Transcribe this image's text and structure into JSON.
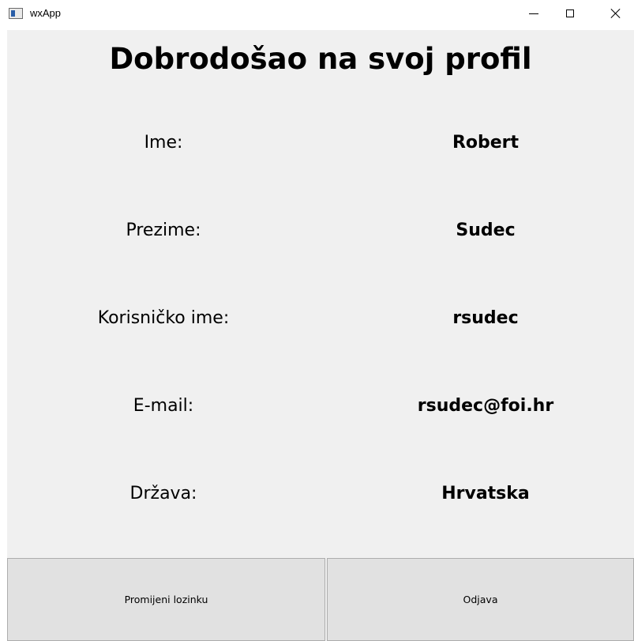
{
  "window": {
    "title": "wxApp",
    "icon": "app-window-icon",
    "controls": {
      "minimize": "minimize-icon",
      "maximize": "maximize-icon",
      "close": "close-icon"
    }
  },
  "profile": {
    "heading": "Dobrodošao na svoj profil",
    "fields": [
      {
        "label": "Ime:",
        "value": "Robert"
      },
      {
        "label": "Prezime:",
        "value": "Sudec"
      },
      {
        "label": "Korisničko ime:",
        "value": "rsudec"
      },
      {
        "label": "E-mail:",
        "value": "rsudec@foi.hr"
      },
      {
        "label": "Država:",
        "value": "Hrvatska"
      }
    ]
  },
  "actions": {
    "change_password_label": "Promijeni lozinku",
    "logout_label": "Odjava"
  },
  "colors": {
    "client_background": "#f0f0f0",
    "button_background": "#e1e1e1",
    "button_border": "#adadad"
  }
}
